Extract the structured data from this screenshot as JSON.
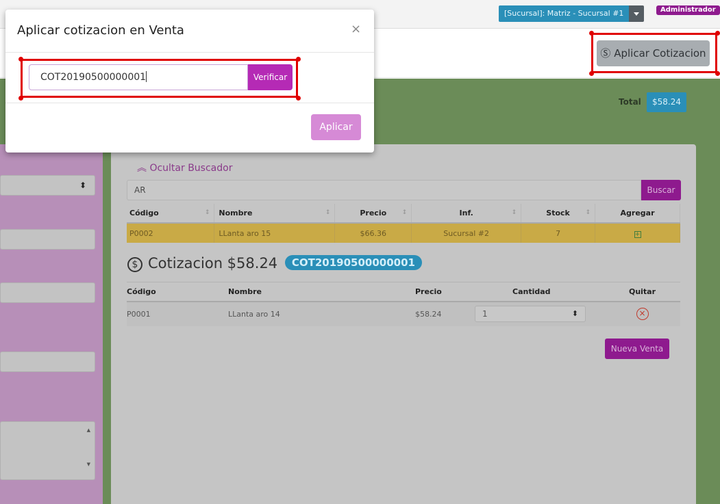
{
  "topbar": {
    "branch_label": "[Sucursal]: Matriz - Sucursal #1",
    "user_badge": "Administrador"
  },
  "header": {
    "apply_quote_label": "Aplicar Cotizacion"
  },
  "summary": {
    "total_label": "Total",
    "total_value": "$58.24"
  },
  "search": {
    "toggle_label": "Ocultar Buscador",
    "query": "AR",
    "button_label": "Buscar"
  },
  "products_table": {
    "headers": [
      "Código",
      "Nombre",
      "Precio",
      "Inf.",
      "Stock",
      "Agregar"
    ],
    "rows": [
      {
        "code": "P0002",
        "name": "LLanta aro 15",
        "price": "$66.36",
        "info": "Sucursal #2",
        "stock": "7",
        "add_icon": "plus-square-icon"
      }
    ]
  },
  "quote": {
    "title": "Cotizacion $58.24",
    "code": "COT20190500000001",
    "icon": "coin-icon",
    "headers": [
      "Código",
      "Nombre",
      "Precio",
      "Cantidad",
      "Quitar"
    ],
    "rows": [
      {
        "code": "P0001",
        "name": "LLanta aro 14",
        "price": "$58.24",
        "quantity": "1",
        "remove_icon": "circle-x-icon"
      }
    ]
  },
  "new_sale_label": "Nueva Venta",
  "modal": {
    "title": "Aplicar cotizacion en Venta",
    "close_glyph": "×",
    "input_value": "COT20190500000001",
    "verify_label": "Verificar",
    "apply_label": "Aplicar"
  },
  "colors": {
    "accent_purple": "#8e1a8e",
    "info_blue": "#2a8fb8",
    "highlight_red": "#e00000",
    "panel_green": "#6b8c58"
  }
}
